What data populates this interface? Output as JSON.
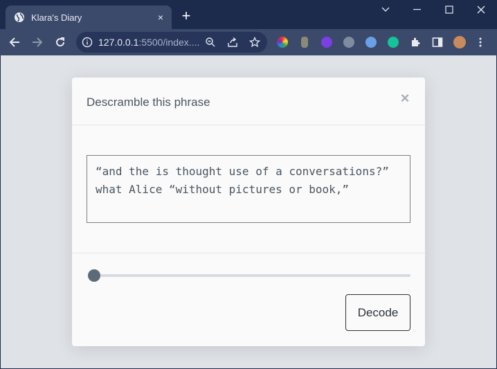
{
  "browser": {
    "tab_title": "Klara's Diary",
    "tab_close": "×",
    "new_tab": "+",
    "url_host": "127.0.0.1",
    "url_rest": ":5500/index....",
    "colors": {
      "frame": "#1c2a4c",
      "toolbar": "#3b4a6b",
      "omnibox": "#27355a"
    }
  },
  "modal": {
    "title": "Descramble this phrase",
    "close_glyph": "×",
    "phrase": "“and the is thought use of a conversations?” what Alice “without pictures or book,”",
    "slider_value": 0,
    "decode_label": "Decode"
  }
}
